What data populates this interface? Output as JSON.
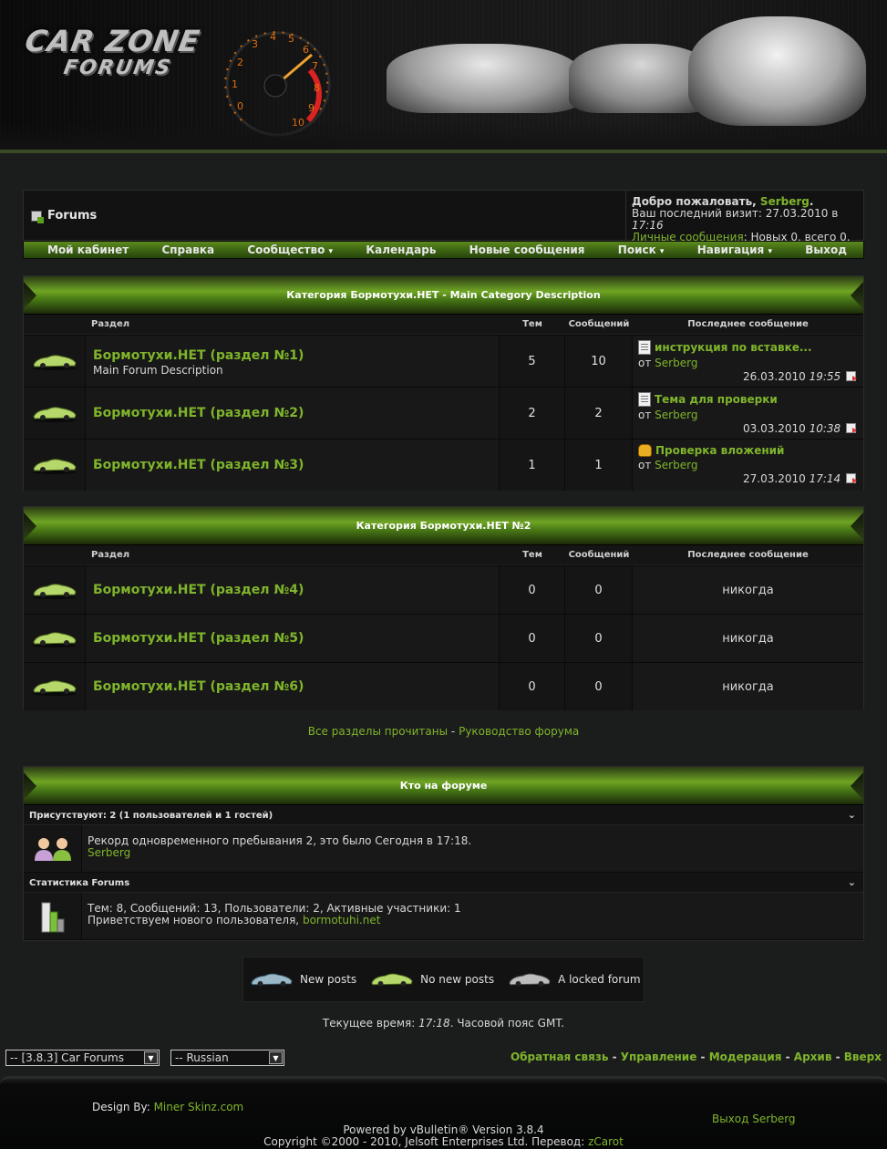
{
  "header": {
    "logo_line1": "CAR ZONE",
    "logo_line2": "FORUMS"
  },
  "breadcrumb": {
    "title": "Forums"
  },
  "welcome": {
    "greeting": "Добро пожаловать,",
    "username": "Serberg",
    "last_visit_label": "Ваш последний визит:",
    "last_visit_date": "27.03.2010",
    "in": "в",
    "last_visit_time": "17:16",
    "pm_label": "Личные сообщения",
    "pm_stats": ": Новых 0, всего 0."
  },
  "navbar": [
    {
      "label": "Мой кабинет",
      "dropdown": false
    },
    {
      "label": "Справка",
      "dropdown": false
    },
    {
      "label": "Сообщество",
      "dropdown": true
    },
    {
      "label": "Календарь",
      "dropdown": false
    },
    {
      "label": "Новые сообщения",
      "dropdown": false
    },
    {
      "label": "Поиск",
      "dropdown": true
    },
    {
      "label": "Навигация",
      "dropdown": true
    },
    {
      "label": "Выход",
      "dropdown": false
    }
  ],
  "columns": {
    "forum": "Раздел",
    "threads": "Тем",
    "posts": "Сообщений",
    "last_post": "Последнее сообщение"
  },
  "categories": [
    {
      "title": "Категория Бормотухи.НЕТ - Main Category Description",
      "forums": [
        {
          "name": "Бормотухи.НЕТ (раздел №1)",
          "desc": "Main Forum Description",
          "threads": "5",
          "posts": "10",
          "last": {
            "title": "инструкция по вставке...",
            "by_label": "от",
            "by": "Serberg",
            "date": "26.03.2010",
            "time": "19:55",
            "icon": "document-icon"
          }
        },
        {
          "name": "Бормотухи.НЕТ (раздел №2)",
          "desc": "",
          "threads": "2",
          "posts": "2",
          "last": {
            "title": "Тема для проверки",
            "by_label": "от",
            "by": "Serberg",
            "date": "03.03.2010",
            "time": "10:38",
            "icon": "document-icon"
          }
        },
        {
          "name": "Бормотухи.НЕТ (раздел №3)",
          "desc": "",
          "threads": "1",
          "posts": "1",
          "last": {
            "title": "Проверка вложений",
            "by_label": "от",
            "by": "Serberg",
            "date": "27.03.2010",
            "time": "17:14",
            "icon": "thumbs-up-icon"
          }
        }
      ]
    },
    {
      "title": "Категория Бормотухи.НЕТ №2",
      "forums": [
        {
          "name": "Бормотухи.НЕТ (раздел №4)",
          "threads": "0",
          "posts": "0",
          "never": "никогда"
        },
        {
          "name": "Бормотухи.НЕТ (раздел №5)",
          "threads": "0",
          "posts": "0",
          "never": "никогда"
        },
        {
          "name": "Бормотухи.НЕТ (раздел №6)",
          "threads": "0",
          "posts": "0",
          "never": "никогда"
        }
      ]
    }
  ],
  "mid_links": {
    "mark_read": "Все разделы прочитаны",
    "sep": "-",
    "guide": "Руководство форума"
  },
  "wol": {
    "title": "Кто на форуме",
    "present": "Присутствуют: 2 (1 пользователей и 1 гостей)",
    "record": "Рекорд одновременного пребывания 2, это было Сегодня в 17:18.",
    "online_user": "Serberg",
    "stats_title": "Статистика Forums",
    "stats": "Тем: 8, Сообщений: 13, Пользователи: 2, Активные участники: 1",
    "welcome_new": "Приветствуем нового пользователя,",
    "new_user": "bormotuhi.net"
  },
  "legend": {
    "new": "New posts",
    "nonew": "No new posts",
    "locked": "A locked forum"
  },
  "time": {
    "label": "Текущее время:",
    "value": "17:18",
    "tz": ". Часовой пояс GMT."
  },
  "selects": {
    "style": "-- [3.8.3] Car Forums",
    "lang": "-- Russian"
  },
  "footer_links": [
    "Обратная связь",
    "Управление",
    "Модерация",
    "Архив",
    "Вверх"
  ],
  "footer_sep": "-",
  "design": {
    "label": "Design By:",
    "name": "Miner Skinz.com"
  },
  "logout": "Выход Serberg",
  "powered": {
    "line1": "Powered by vBulletin® Version 3.8.4",
    "line2": "Copyright ©2000 - 2010, Jelsoft Enterprises Ltd. Перевод:",
    "translator": "zCarot"
  },
  "colors": {
    "accent": "#7fb52b",
    "bg": "#1b1c1c",
    "panel": "#141414"
  }
}
